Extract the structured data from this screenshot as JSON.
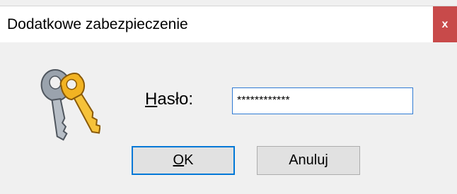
{
  "dialog": {
    "title": "Dodatkowe zabezpieczenie",
    "close_label": "x",
    "icon": "keys-icon",
    "password_label_accel": "H",
    "password_label_rest": "asło:",
    "password_value": "************",
    "ok_accel": "O",
    "ok_rest": "K",
    "cancel_prefix": "Anulu",
    "cancel_accel": "j"
  },
  "colors": {
    "close_button": "#c84a4a",
    "focus_border": "#0078d7",
    "input_border": "#2f7ad3",
    "background": "#f0f0f0"
  }
}
